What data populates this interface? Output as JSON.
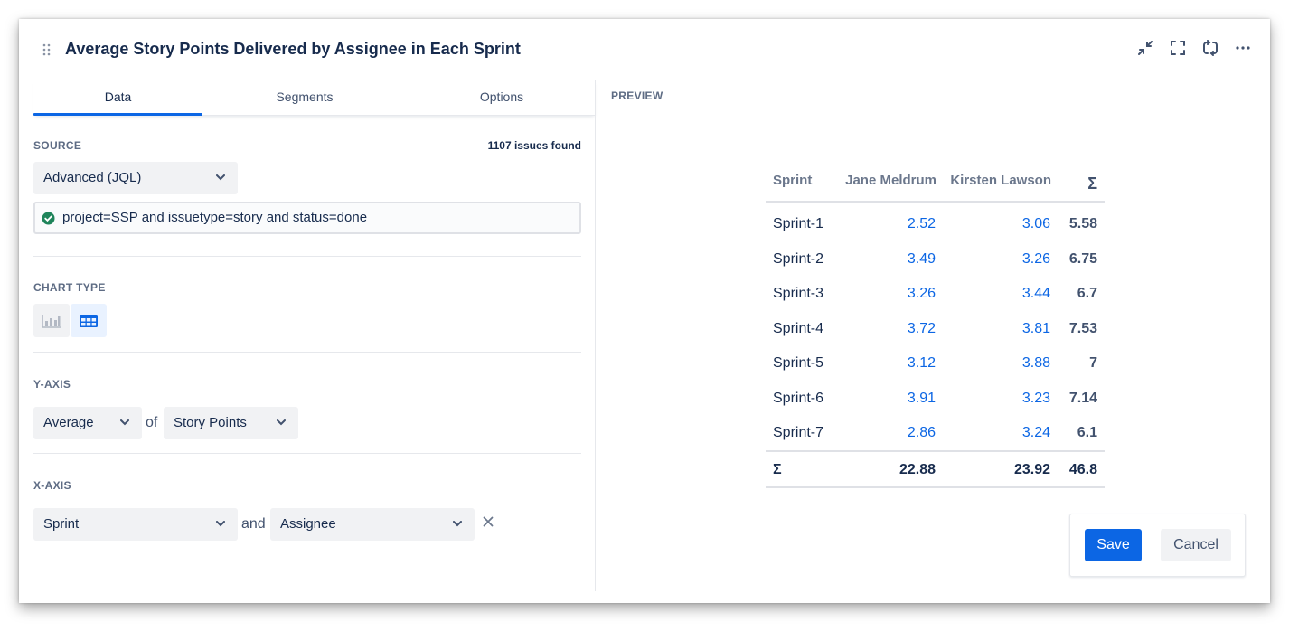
{
  "header": {
    "title": "Average Story Points Delivered by Assignee in Each Sprint",
    "icons": [
      "drag-handle-icon",
      "collapse-icon",
      "expand-icon",
      "refresh-icon",
      "more-icon"
    ]
  },
  "tabs": [
    {
      "label": "Data",
      "active": true
    },
    {
      "label": "Segments",
      "active": false
    },
    {
      "label": "Options",
      "active": false
    }
  ],
  "source": {
    "label": "SOURCE",
    "count": "1107 issues found",
    "select_value": "Advanced (JQL)",
    "jql": "project=SSP and issuetype=story and status=done"
  },
  "chart_type": {
    "label": "CHART TYPE",
    "options": [
      {
        "icon": "bar-chart-icon",
        "selected": false
      },
      {
        "icon": "table-icon",
        "selected": true
      }
    ]
  },
  "y_axis": {
    "label": "Y-AXIS",
    "aggregate": "Average",
    "connector": "of",
    "field": "Story Points"
  },
  "x_axis": {
    "label": "X-AXIS",
    "field1": "Sprint",
    "connector": "and",
    "field2": "Assignee"
  },
  "preview": {
    "label": "PREVIEW",
    "table": {
      "headers": [
        "Sprint",
        "Jane Meldrum",
        "Kirsten Lawson",
        "Σ"
      ],
      "rows": [
        [
          "Sprint-1",
          "2.52",
          "3.06",
          "5.58"
        ],
        [
          "Sprint-2",
          "3.49",
          "3.26",
          "6.75"
        ],
        [
          "Sprint-3",
          "3.26",
          "3.44",
          "6.7"
        ],
        [
          "Sprint-4",
          "3.72",
          "3.81",
          "7.53"
        ],
        [
          "Sprint-5",
          "3.12",
          "3.88",
          "7"
        ],
        [
          "Sprint-6",
          "3.91",
          "3.23",
          "7.14"
        ],
        [
          "Sprint-7",
          "2.86",
          "3.24",
          "6.1"
        ]
      ],
      "footer": [
        "Σ",
        "22.88",
        "23.92",
        "46.8"
      ]
    }
  },
  "actions": {
    "save": "Save",
    "cancel": "Cancel"
  },
  "colors": {
    "accent": "#0c66e4",
    "success": "#1f845a",
    "text": "#172b4d",
    "subtle": "#5e6c84"
  }
}
